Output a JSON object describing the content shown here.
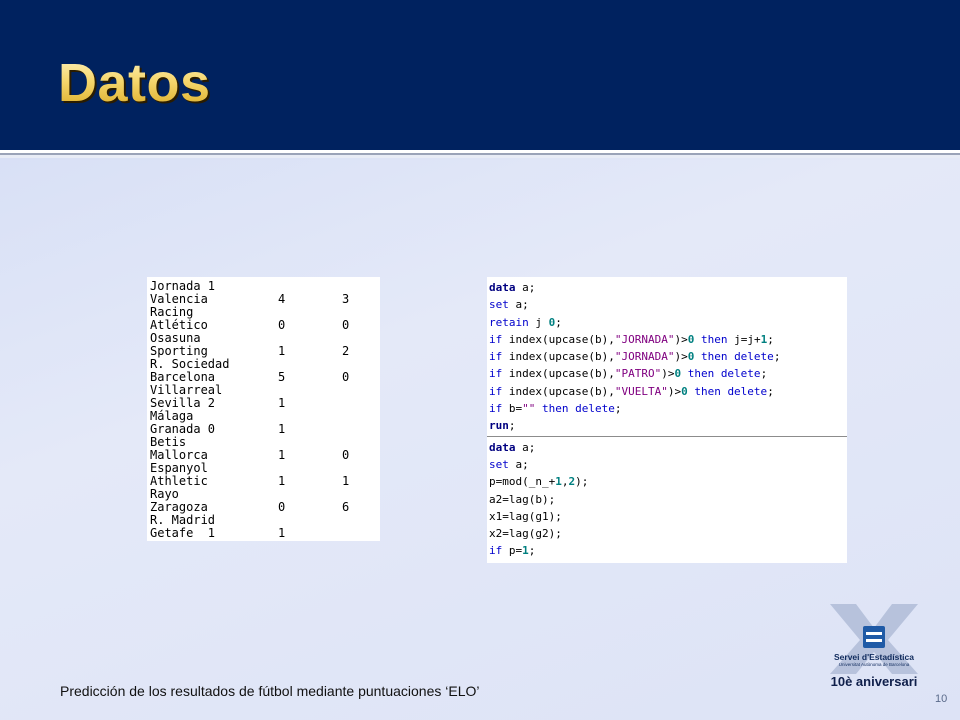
{
  "slide": {
    "title": "Datos",
    "footer": "Predicción de los resultados de fútbol mediante puntuaciones ‘ELO’",
    "page_number": "10"
  },
  "data_table": {
    "rows": [
      {
        "team": "Jornada 1",
        "g1": "",
        "g2": ""
      },
      {
        "team": "Valencia",
        "g1": "4",
        "g2": "3"
      },
      {
        "team": "Racing",
        "g1": "",
        "g2": ""
      },
      {
        "team": "Atlético",
        "g1": "0",
        "g2": "0"
      },
      {
        "team": "Osasuna",
        "g1": "",
        "g2": ""
      },
      {
        "team": "Sporting",
        "g1": "1",
        "g2": "2"
      },
      {
        "team": "R. Sociedad",
        "g1": "",
        "g2": ""
      },
      {
        "team": "Barcelona",
        "g1": "5",
        "g2": "0"
      },
      {
        "team": "Villarreal",
        "g1": "",
        "g2": ""
      },
      {
        "team": "Sevilla 2",
        "g1": "1",
        "g2": ""
      },
      {
        "team": "Málaga",
        "g1": "",
        "g2": ""
      },
      {
        "team": "Granada 0",
        "g1": "1",
        "g2": ""
      },
      {
        "team": "Betis",
        "g1": "",
        "g2": ""
      },
      {
        "team": "Mallorca",
        "g1": "1",
        "g2": "0"
      },
      {
        "team": "Espanyol",
        "g1": "",
        "g2": ""
      },
      {
        "team": "Athletic",
        "g1": "1",
        "g2": "1"
      },
      {
        "team": "Rayo",
        "g1": "",
        "g2": ""
      },
      {
        "team": "Zaragoza",
        "g1": "0",
        "g2": "6"
      },
      {
        "team": "R. Madrid",
        "g1": "",
        "g2": ""
      },
      {
        "team": "Getafe  1",
        "g1": "1",
        "g2": ""
      }
    ]
  },
  "code": {
    "block1": [
      [
        {
          "t": "data",
          "c": "kb"
        },
        {
          "t": " a;",
          "c": "txt"
        }
      ],
      [
        {
          "t": "set",
          "c": "kw"
        },
        {
          "t": " a;",
          "c": "txt"
        }
      ],
      [
        {
          "t": "retain",
          "c": "kw"
        },
        {
          "t": " j ",
          "c": "txt"
        },
        {
          "t": "0",
          "c": "num"
        },
        {
          "t": ";",
          "c": "txt"
        }
      ],
      [
        {
          "t": "if",
          "c": "kw"
        },
        {
          "t": " index(upcase(b),",
          "c": "txt"
        },
        {
          "t": "\"JORNADA\"",
          "c": "str"
        },
        {
          "t": ")>",
          "c": "txt"
        },
        {
          "t": "0",
          "c": "num"
        },
        {
          "t": " then",
          "c": "kw"
        },
        {
          "t": " j=j+",
          "c": "txt"
        },
        {
          "t": "1",
          "c": "num"
        },
        {
          "t": ";",
          "c": "txt"
        }
      ],
      [
        {
          "t": "if",
          "c": "kw"
        },
        {
          "t": " index(upcase(b),",
          "c": "txt"
        },
        {
          "t": "\"JORNADA\"",
          "c": "str"
        },
        {
          "t": ")>",
          "c": "txt"
        },
        {
          "t": "0",
          "c": "num"
        },
        {
          "t": " then delete",
          "c": "kw"
        },
        {
          "t": ";",
          "c": "txt"
        }
      ],
      [
        {
          "t": "if",
          "c": "kw"
        },
        {
          "t": " index(upcase(b),",
          "c": "txt"
        },
        {
          "t": "\"PATRO\"",
          "c": "str"
        },
        {
          "t": ")>",
          "c": "txt"
        },
        {
          "t": "0",
          "c": "num"
        },
        {
          "t": " then delete",
          "c": "kw"
        },
        {
          "t": ";",
          "c": "txt"
        }
      ],
      [
        {
          "t": "if",
          "c": "kw"
        },
        {
          "t": " index(upcase(b),",
          "c": "txt"
        },
        {
          "t": "\"VUELTA\"",
          "c": "str"
        },
        {
          "t": ")>",
          "c": "txt"
        },
        {
          "t": "0",
          "c": "num"
        },
        {
          "t": " then delete",
          "c": "kw"
        },
        {
          "t": ";",
          "c": "txt"
        }
      ],
      [
        {
          "t": "if",
          "c": "kw"
        },
        {
          "t": " b=",
          "c": "txt"
        },
        {
          "t": "\"\"",
          "c": "str"
        },
        {
          "t": " then delete",
          "c": "kw"
        },
        {
          "t": ";",
          "c": "txt"
        }
      ],
      [
        {
          "t": "run",
          "c": "kb"
        },
        {
          "t": ";",
          "c": "txt"
        }
      ]
    ],
    "block2": [
      [
        {
          "t": "data",
          "c": "kb"
        },
        {
          "t": " a;",
          "c": "txt"
        }
      ],
      [
        {
          "t": "set",
          "c": "kw"
        },
        {
          "t": " a;",
          "c": "txt"
        }
      ],
      [
        {
          "t": "p=mod(_n_+",
          "c": "txt"
        },
        {
          "t": "1",
          "c": "num"
        },
        {
          "t": ",",
          "c": "txt"
        },
        {
          "t": "2",
          "c": "num"
        },
        {
          "t": ");",
          "c": "txt"
        }
      ],
      [
        {
          "t": "a2=lag(b);",
          "c": "txt"
        }
      ],
      [
        {
          "t": "x1=lag(g1);",
          "c": "txt"
        }
      ],
      [
        {
          "t": "x2=lag(g2);",
          "c": "txt"
        }
      ],
      [
        {
          "t": "if",
          "c": "kw"
        },
        {
          "t": " p=",
          "c": "txt"
        },
        {
          "t": "1",
          "c": "num"
        },
        {
          "t": ";",
          "c": "txt"
        }
      ],
      [
        {
          "t": "run",
          "c": "kb"
        },
        {
          "t": ";",
          "c": "txt"
        }
      ]
    ]
  },
  "logo": {
    "name": "Servei d'Estadística",
    "subtitle": "Universitat Autònoma de Barcelona",
    "anniversary": "10è aniversari",
    "colors": {
      "x_shape": "#b7c2dc",
      "mark": "#1f5aa6",
      "text": "#0f2a5c"
    }
  },
  "colors": {
    "header": "#00225f",
    "title_gold": "#f6d870",
    "background": "#d3dcf5"
  }
}
